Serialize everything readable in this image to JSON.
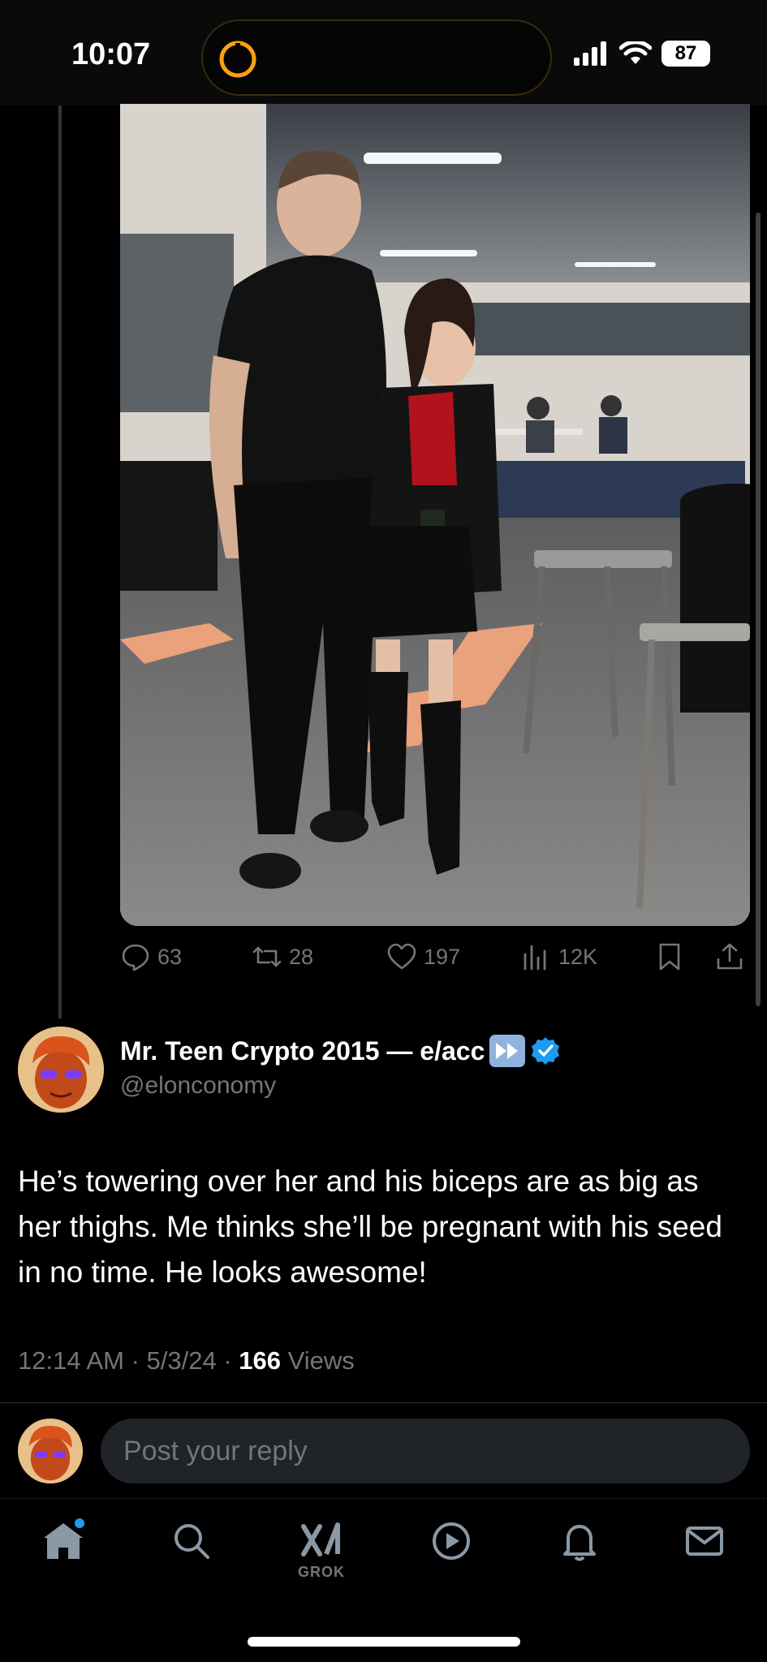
{
  "status_bar": {
    "time": "10:07",
    "battery": "87"
  },
  "image": {
    "description_icon": "photo"
  },
  "actions": {
    "replies": "63",
    "reposts": "28",
    "likes": "197",
    "views": "12K"
  },
  "reply": {
    "display_name": "Mr. Teen Crypto 2015 — e/acc",
    "handle": "@elonconomy",
    "verified": true,
    "text": "He’s towering over her and his biceps are as big as her thighs. Me thinks she’ll be pregnant with his seed in no time. He looks awesome!",
    "timestamp": "12:14 AM · 5/3/24 · ",
    "views_count": "166",
    "views_label": " Views"
  },
  "composer": {
    "placeholder": "Post your reply"
  },
  "tabbar": {
    "grok_label": "GROK"
  },
  "colors": {
    "accent": "#1d9bf0",
    "muted": "#71767b"
  }
}
